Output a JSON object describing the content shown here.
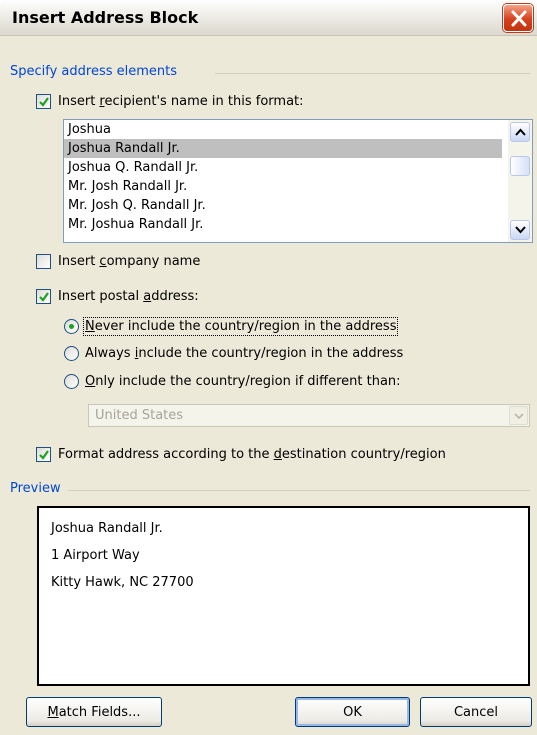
{
  "window": {
    "title": "Insert Address Block"
  },
  "address_elements": {
    "group_label": "Specify address elements",
    "recipient_name": {
      "checked": true,
      "label": "Insert recipient's name in this format:",
      "formats": [
        "Joshua",
        "Joshua Randall Jr.",
        "Joshua Q. Randall Jr.",
        "Mr. Josh Randall Jr.",
        "Mr. Josh Q. Randall Jr.",
        "Mr. Joshua Randall Jr."
      ],
      "selected_format": "Joshua Randall Jr."
    },
    "company_name": {
      "checked": false,
      "label": "Insert company name"
    },
    "postal_address": {
      "checked": true,
      "label": "Insert postal address:",
      "options": [
        "Never include the country/region in the address",
        "Always include the country/region in the address",
        "Only include the country/region if different than:"
      ],
      "selected_option": "Never include the country/region in the address",
      "country_select": {
        "value": "United States",
        "disabled": true
      }
    },
    "format_by_destination": {
      "checked": true,
      "label": "Format address according to the destination country/region"
    }
  },
  "preview": {
    "group_label": "Preview",
    "lines": [
      "Joshua Randall Jr.",
      "1 Airport Way",
      "Kitty Hawk, NC 27700"
    ]
  },
  "buttons": {
    "match_fields": "Match Fields...",
    "ok": "OK",
    "cancel": "Cancel"
  },
  "colors": {
    "group_label": "#0046d5",
    "dialog_bg": "#ece9d8",
    "check": "#21a121"
  },
  "icons": {
    "close": "close-icon",
    "checkmark": "checkmark-icon",
    "scroll_up": "chevron-up-icon",
    "scroll_down": "chevron-down-icon",
    "dropdown": "chevron-down-icon"
  }
}
